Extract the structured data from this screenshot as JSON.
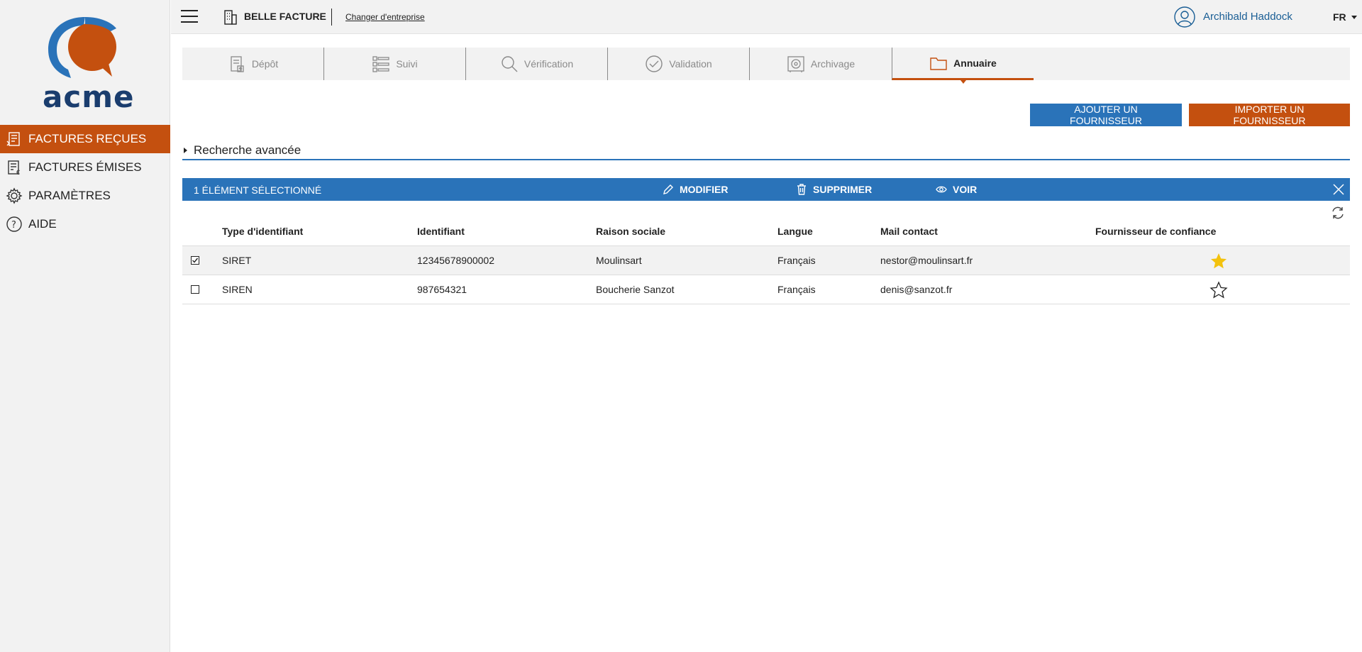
{
  "sidebar": {
    "logo_text": "acme",
    "items": [
      {
        "label": "FACTURES REÇUES",
        "icon": "invoice-received-icon",
        "active": true
      },
      {
        "label": "FACTURES ÉMISES",
        "icon": "invoice-issued-icon",
        "active": false
      },
      {
        "label": "PARAMÈTRES",
        "icon": "gear-icon",
        "active": false
      },
      {
        "label": "AIDE",
        "icon": "help-icon",
        "active": false
      }
    ]
  },
  "topbar": {
    "company": "BELLE FACTURE",
    "change_company": "Changer d'entreprise",
    "user_name": "Archibald Haddock",
    "language": "FR"
  },
  "tabs": [
    {
      "label": "Dépôt",
      "icon": "upload-document-icon",
      "active": false
    },
    {
      "label": "Suivi",
      "icon": "list-tracking-icon",
      "active": false
    },
    {
      "label": "Vérification",
      "icon": "magnifier-icon",
      "active": false
    },
    {
      "label": "Validation",
      "icon": "check-circle-icon",
      "active": false
    },
    {
      "label": "Archivage",
      "icon": "safe-icon",
      "active": false
    },
    {
      "label": "Annuaire",
      "icon": "folder-icon",
      "active": true
    }
  ],
  "actions": {
    "add_supplier": "AJOUTER UN FOURNISSEUR",
    "import_supplier": "IMPORTER UN FOURNISSEUR"
  },
  "advanced_search": {
    "label": "Recherche avancée"
  },
  "selection_bar": {
    "count_label": "1 ÉLÉMENT SÉLECTIONNÉ",
    "edit": "MODIFIER",
    "delete": "SUPPRIMER",
    "view": "VOIR"
  },
  "table": {
    "columns": [
      "Type d'identifiant",
      "Identifiant",
      "Raison sociale",
      "Langue",
      "Mail contact",
      "Fournisseur de confiance"
    ],
    "rows": [
      {
        "selected": true,
        "type": "SIRET",
        "id": "12345678900002",
        "name": "Moulinsart",
        "lang": "Français",
        "mail": "nestor@moulinsart.fr",
        "trusted": true
      },
      {
        "selected": false,
        "type": "SIREN",
        "id": "987654321",
        "name": "Boucherie Sanzot",
        "lang": "Français",
        "mail": "denis@sanzot.fr",
        "trusted": false
      }
    ]
  },
  "colors": {
    "accent_orange": "#c4500f",
    "accent_blue": "#2a73b9",
    "star_gold": "#f3c20e"
  }
}
